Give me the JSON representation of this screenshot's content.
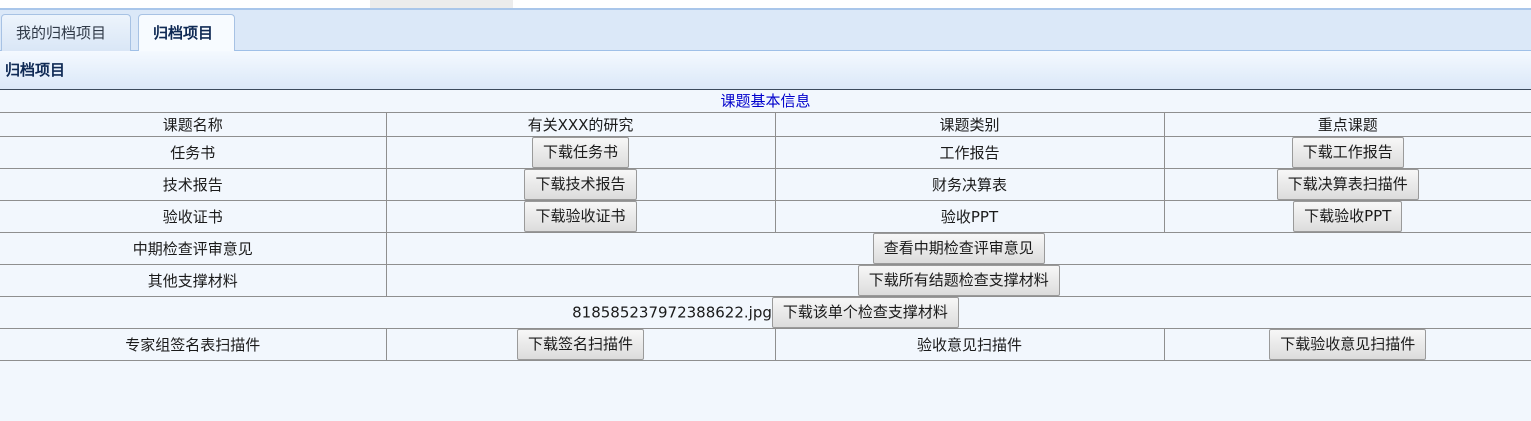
{
  "tabs": [
    {
      "label": "我的归档项目",
      "active": false
    },
    {
      "label": "归档项目",
      "active": true
    }
  ],
  "section_title": "归档项目",
  "table": {
    "caption": "课题基本信息",
    "header": {
      "name_label": "课题名称",
      "name_value": "有关XXX的研究",
      "category_label": "课题类别",
      "category_value": "重点课题"
    },
    "rows": {
      "task_book": {
        "label": "任务书",
        "button": "下载任务书"
      },
      "work_report": {
        "label": "工作报告",
        "button": "下载工作报告"
      },
      "tech_report": {
        "label": "技术报告",
        "button": "下载技术报告"
      },
      "financial": {
        "label": "财务决算表",
        "button": "下载决算表扫描件"
      },
      "acceptance_cert": {
        "label": "验收证书",
        "button": "下载验收证书"
      },
      "acceptance_ppt": {
        "label": "验收PPT",
        "button": "下载验收PPT"
      },
      "midterm": {
        "label": "中期检查评审意见",
        "button": "查看中期检查评审意见"
      },
      "other_materials": {
        "label": "其他支撑材料",
        "button": "下载所有结题检查支撑材料"
      },
      "single_file": {
        "filename": "818585237972388622.jpg",
        "button": "下载该单个检查支撑材料"
      },
      "expert_signature": {
        "label": "专家组签名表扫描件",
        "button": "下载签名扫描件"
      },
      "acceptance_opinion": {
        "label": "验收意见扫描件",
        "button": "下载验收意见扫描件"
      }
    }
  },
  "colors": {
    "tabbar_bg": "#dbe8f8",
    "page_bg": "#f2f7fd",
    "caption_text": "#0000cc",
    "title_text": "#0f2a55"
  }
}
